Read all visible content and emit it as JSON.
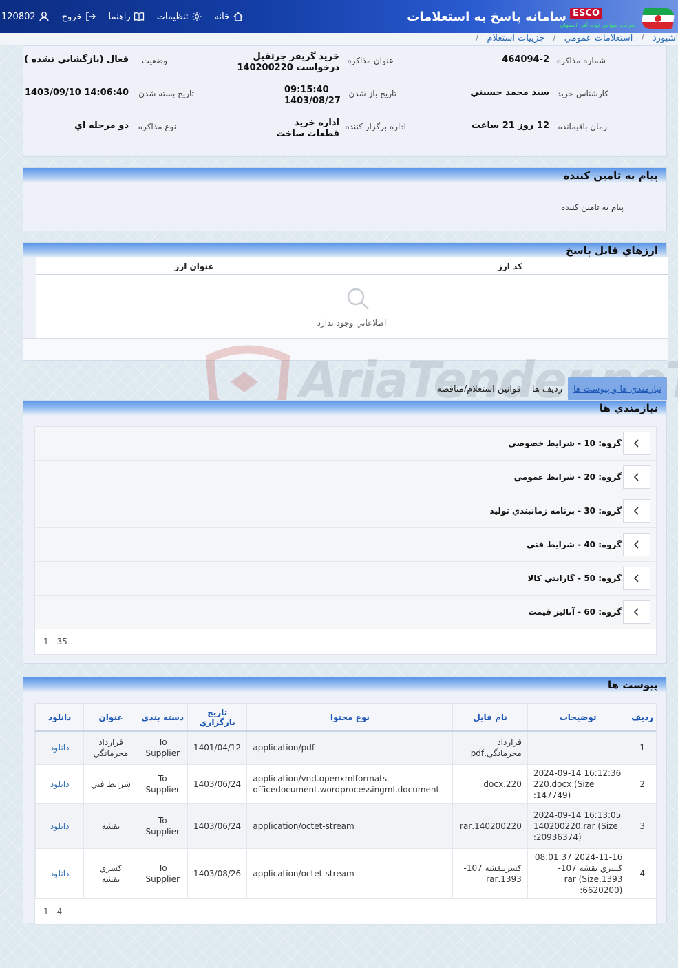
{
  "header": {
    "title": "سامانه پاسخ به استعلامات",
    "brand": "ESCO",
    "brand_sub": "شرکت سهامی ذوب آهن اصفهان",
    "nav": {
      "home": "خانه",
      "settings": "تنظیمات",
      "guide": "راهنما",
      "logout": "خروج",
      "user_id": "120802"
    }
  },
  "breadcrumb": {
    "dashboard": "داشبورد",
    "general": "استعلامات عمومي",
    "details": "جزييات استعلام"
  },
  "info": {
    "number_label": "شماره مذاکره",
    "number_value": "464094-2",
    "title_label": "عنوان مذاکره",
    "title_value": "خريد گريفر جرثقيل درخواست 140200220",
    "status_label": "وضعيت",
    "status_value": "فعال (بازگشايي نشده )",
    "expert_label": "کارشناس خريد",
    "expert_value": "سيد محمد حسيني",
    "open_label": "تاريخ باز شدن",
    "open_value": "09:15:40 1403/08/27",
    "close_label": "تاريخ بسته شدن",
    "close_value": "1403/09/10 14:06:40",
    "remaining_label": "زمان باقيمانده",
    "remaining_value": "12 روز 21 ساعت",
    "office_label": "اداره برگزار کننده",
    "office_value": "اداره خريد قطعات ساخت",
    "type_label": "نوع مذاکره",
    "type_value": "دو مرحله اي"
  },
  "message_panel": {
    "title": "پيام به تامين کننده",
    "body": "پيام به تامين کننده"
  },
  "currency_panel": {
    "title": "ارزهاي قابل پاسخ",
    "col_code": "کد ارز",
    "col_title": "عنوان ارز",
    "empty": "اطلاعاتي وجود ندارد"
  },
  "tabs": [
    "نيازمندي ها و پيوست ها",
    "رديف ها",
    "قوانين استعلام/مناقصه"
  ],
  "needs": {
    "title": "نيازمندي ها",
    "groups": [
      "گروه: 10 - شرايط خصوصي",
      "گروه: 20 - شرايط عمومي",
      "گروه: 30 - برنامه زمانبندي توليد",
      "گروه: 40 - شرايط فني",
      "گروه: 50 - گارانتي کالا",
      "گروه: 60 - آناليز قيمت"
    ],
    "pager": "1 - 35"
  },
  "attachments": {
    "title": "پيوست ها",
    "columns": [
      "رديف",
      "توضيحات",
      "نام فايل",
      "نوع محتوا",
      "تاريخ بارگزاري",
      "دسته بندي",
      "عنوان",
      "دانلود"
    ],
    "rows": [
      [
        "1",
        "",
        "قرارداد محرمانگي.pdf",
        "application/pdf",
        "1401/04/12",
        "To Supplier",
        "قرارداد محرمانگي",
        "دانلود"
      ],
      [
        "2",
        "2024-09-14 16:12:36 220.docx (Size :147749)",
        "220.docx",
        "application/vnd.openxmlformats-officedocument.wordprocessingml.document",
        "1403/06/24",
        "To Supplier",
        "شرايط فني",
        "دانلود"
      ],
      [
        "3",
        "2024-09-14 16:13:05 140200220.rar (Size :20936374)",
        "140200220.rar",
        "application/octet-stream",
        "1403/06/24",
        "To Supplier",
        "نقشه",
        "دانلود"
      ],
      [
        "4",
        "2024-11-16 08:01:37 کسري نقشه 107-1393.rar (Size :6620200)",
        "کسرينقشه 107-1393.rar",
        "application/octet-stream",
        "1403/08/26",
        "To Supplier",
        "کسري نقشه",
        "دانلود"
      ]
    ],
    "pager": "1 - 4"
  },
  "watermark": "AriaTender.neT"
}
